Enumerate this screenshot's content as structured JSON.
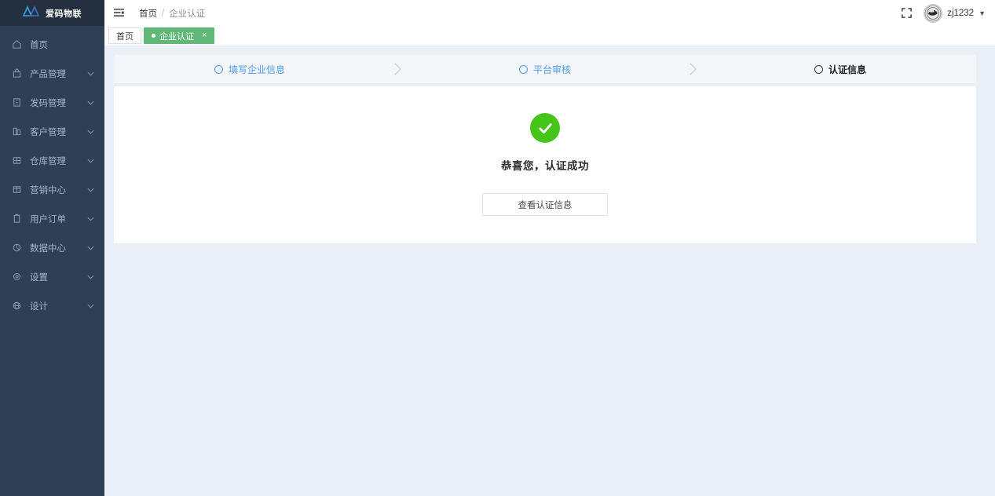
{
  "colors": {
    "sidebar_bg": "#2f4056",
    "sidebar_logo_bg": "#24303f",
    "page_bg": "#eaeef5",
    "accent_green": "#5fb878",
    "success_green": "#45c41a",
    "step_blue": "#4a9bf5",
    "step_current": "#232323",
    "steps_bg": "#f4f6fa"
  },
  "sidebar": {
    "logo": {
      "icon": "mountain-logo-icon",
      "text": "爱码物联"
    },
    "items": [
      {
        "label": "首页",
        "icon": "home-icon",
        "expandable": false
      },
      {
        "label": "产品管理",
        "icon": "bag-icon",
        "expandable": true
      },
      {
        "label": "发码管理",
        "icon": "code-book-icon",
        "expandable": true
      },
      {
        "label": "客户管理",
        "icon": "building-icon",
        "expandable": true
      },
      {
        "label": "仓库管理",
        "icon": "grid-icon",
        "expandable": true
      },
      {
        "label": "营销中心",
        "icon": "table-icon",
        "expandable": true
      },
      {
        "label": "用户订单",
        "icon": "clipboard-icon",
        "expandable": true
      },
      {
        "label": "数据中心",
        "icon": "pie-chart-icon",
        "expandable": true
      },
      {
        "label": "设置",
        "icon": "gear-icon",
        "expandable": true
      },
      {
        "label": "设计",
        "icon": "globe-icon",
        "expandable": true
      }
    ]
  },
  "topbar": {
    "menu_toggle_icon": "hamburger-icon",
    "breadcrumb": {
      "home": "首页",
      "separator": "/",
      "current": "企业认证"
    },
    "fullscreen_icon": "fullscreen-icon",
    "user": {
      "avatar_icon": "user-avatar",
      "name": "zj1232",
      "caret": "▼"
    }
  },
  "tabs": [
    {
      "label": "首页",
      "active": false,
      "closable": false
    },
    {
      "label": "企业认证",
      "active": true,
      "closable": true,
      "close_glyph": "×"
    }
  ],
  "steps": [
    {
      "label": "填写企业信息",
      "state": "done"
    },
    {
      "label": "平台审核",
      "state": "done"
    },
    {
      "label": "认证信息",
      "state": "current"
    }
  ],
  "step_arrow_glyph": "›",
  "result": {
    "icon": "success-check-icon",
    "message": "恭喜您，认证成功",
    "button_label": "查看认证信息"
  }
}
